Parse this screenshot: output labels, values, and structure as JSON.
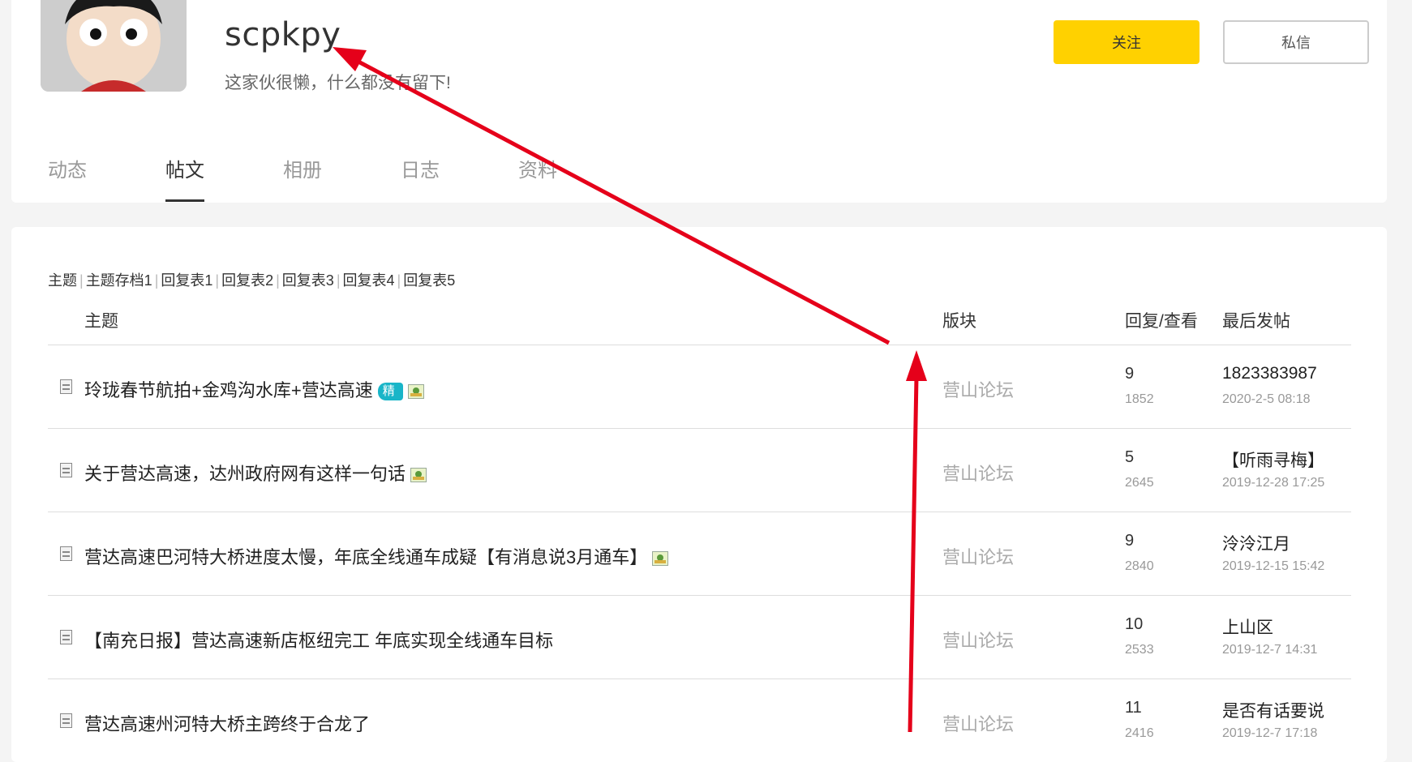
{
  "profile": {
    "username": "scpkpy",
    "bio": "这家伙很懒，什么都没有留下!",
    "follow_label": "关注",
    "message_label": "私信"
  },
  "tabs": [
    {
      "label": "动态",
      "active": false
    },
    {
      "label": "帖文",
      "active": true
    },
    {
      "label": "相册",
      "active": false
    },
    {
      "label": "日志",
      "active": false
    },
    {
      "label": "资料",
      "active": false
    }
  ],
  "subnav": [
    "主题",
    "主题存档1",
    "回复表1",
    "回复表2",
    "回复表3",
    "回复表4",
    "回复表5"
  ],
  "table": {
    "headers": {
      "topic": "主题",
      "forum": "版块",
      "reply_view": "回复/查看",
      "last_post": "最后发帖"
    },
    "rows": [
      {
        "title": "玲珑春节航拍+金鸡沟水库+营达高速",
        "badge": "精",
        "has_image": true,
        "forum": "营山论坛",
        "replies": "9",
        "views": "1852",
        "last_user": "1823383987",
        "last_time": "2020-2-5 08:18"
      },
      {
        "title": "关于营达高速，达州政府网有这样一句话",
        "badge": "",
        "has_image": true,
        "forum": "营山论坛",
        "replies": "5",
        "views": "2645",
        "last_user": "【听雨寻梅】",
        "last_time": "2019-12-28 17:25"
      },
      {
        "title": "营达高速巴河特大桥进度太慢，年底全线通车成疑【有消息说3月通车】",
        "badge": "",
        "has_image": true,
        "forum": "营山论坛",
        "replies": "9",
        "views": "2840",
        "last_user": "泠泠江月",
        "last_time": "2019-12-15 15:42"
      },
      {
        "title": "【南充日报】营达高速新店枢纽完工 年底实现全线通车目标",
        "badge": "",
        "has_image": false,
        "forum": "营山论坛",
        "replies": "10",
        "views": "2533",
        "last_user": "上山区",
        "last_time": "2019-12-7 14:31"
      },
      {
        "title": "营达高速州河特大桥主跨终于合龙了",
        "badge": "",
        "has_image": false,
        "forum": "营山论坛",
        "replies": "11",
        "views": "2416",
        "last_user": "是否有话要说",
        "last_time": "2019-12-7 17:18"
      }
    ]
  },
  "colors": {
    "accent": "#ffd100",
    "arrow": "#e5001a",
    "badge": "#19b5c8"
  }
}
